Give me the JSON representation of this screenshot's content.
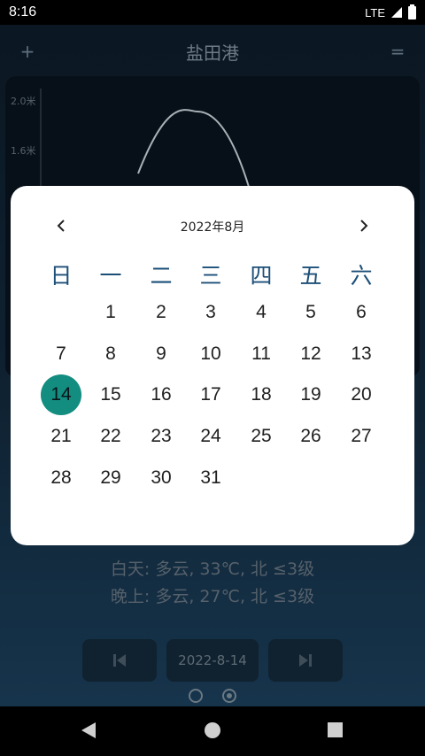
{
  "status_bar": {
    "time": "8:16",
    "network": "LTE"
  },
  "app_bar": {
    "add_label": "+",
    "title": "盐田港",
    "menu_label": "="
  },
  "chart": {
    "y_ticks": [
      "2.0米",
      "1.6米"
    ]
  },
  "weather": {
    "day": "白天: 多云, 33℃, 北 ≤3级",
    "night": "晚上: 多云, 27℃, 北 ≤3级"
  },
  "navigation": {
    "date_label": "2022-8-14"
  },
  "date_picker": {
    "month_title": "2022年8月",
    "weekdays": [
      "日",
      "一",
      "二",
      "三",
      "四",
      "五",
      "六"
    ],
    "days": [
      "1",
      "2",
      "3",
      "4",
      "5",
      "6",
      "7",
      "8",
      "9",
      "10",
      "11",
      "12",
      "13",
      "14",
      "15",
      "16",
      "17",
      "18",
      "19",
      "20",
      "21",
      "22",
      "23",
      "24",
      "25",
      "26",
      "27",
      "28",
      "29",
      "30",
      "31"
    ],
    "selected_day": "14",
    "selected_color": "#138d80",
    "weekday_color": "#1c4f78"
  }
}
